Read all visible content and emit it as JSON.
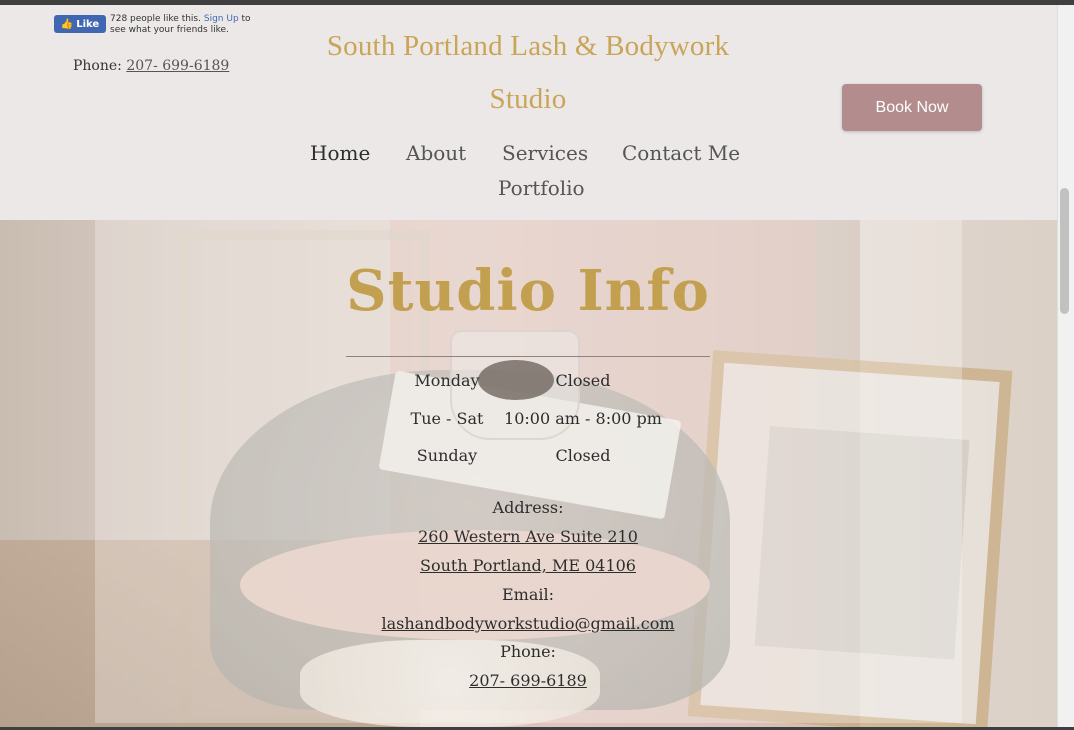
{
  "facebook": {
    "like_label": "Like",
    "count_text": "728 people like this.",
    "signup_link": "Sign Up",
    "suffix_text": "to see what your friends like."
  },
  "header": {
    "phone_label": "Phone:",
    "phone_number": "207- 699-6189",
    "site_title_line1": "South Portland Lash & Bodywork",
    "site_title_line2": "Studio",
    "book_button": "Book Now"
  },
  "nav": {
    "items": [
      {
        "label": "Home"
      },
      {
        "label": "About"
      },
      {
        "label": "Services"
      },
      {
        "label": "Contact Me"
      },
      {
        "label": "Portfolio"
      }
    ]
  },
  "studio_info": {
    "title": "Studio Info",
    "hours": [
      {
        "day": "Monday",
        "time": "Closed"
      },
      {
        "day": "Tue - Sat",
        "time": "10:00 am - 8:00 pm"
      },
      {
        "day": "Sunday",
        "time": "Closed"
      }
    ],
    "address_label": "Address:",
    "address_line1": "260 Western Ave Suite 210",
    "address_line2": "South Portland, ME 04106",
    "email_label": "Email:",
    "email": "lashandbodyworkstudio@gmail.com",
    "phone_label": "Phone:",
    "phone": "207- 699-6189"
  },
  "colors": {
    "accent_gold": "#c9a558",
    "button_mauve": "#b38d8e"
  }
}
